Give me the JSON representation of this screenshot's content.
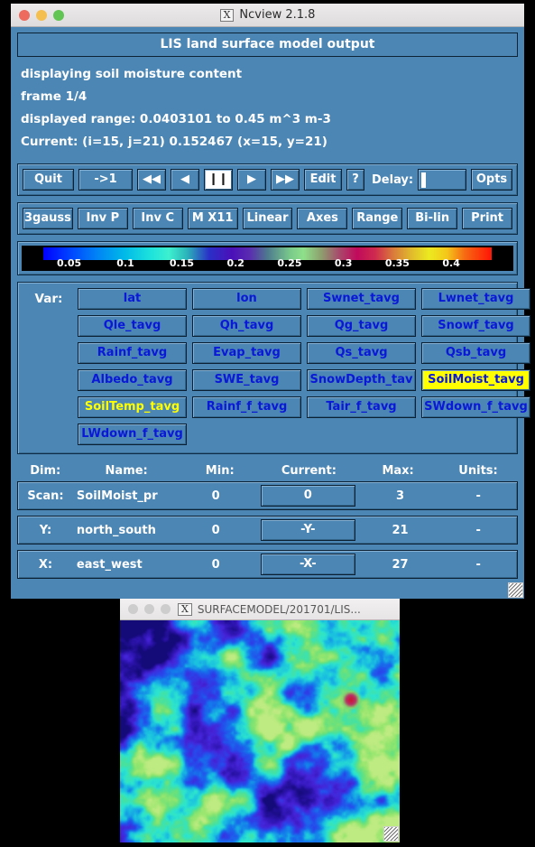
{
  "main_window": {
    "title": "Ncview 2.1.8",
    "x_logo": "X",
    "banner": "LIS land surface model output",
    "info": [
      "displaying soil moisture content",
      "frame 1/4",
      "displayed range: 0.0403101 to 0.45 m^3 m-3",
      "Current: (i=15, j=21) 0.152467 (x=15, y=21)"
    ]
  },
  "toolbar": {
    "quit": "Quit",
    "to_one": "->1",
    "rewind_fast": "◀◀",
    "rewind": "◀",
    "pause": "❙❙",
    "play": "▶",
    "forward_fast": "▶▶",
    "edit": "Edit",
    "help": "?",
    "delay_label": "Delay:",
    "delay_value": "",
    "opts": "Opts"
  },
  "options_bar": [
    "3gauss",
    "Inv P",
    "Inv C",
    "M X11",
    "Linear",
    "Axes",
    "Range",
    "Bi-lin",
    "Print"
  ],
  "colorbar": {
    "ticks": [
      "0.05",
      "0.1",
      "0.15",
      "0.2",
      "0.25",
      "0.3",
      "0.35",
      "0.4"
    ],
    "tick_positions": [
      9.5,
      21.0,
      32.5,
      43.5,
      54.5,
      65.5,
      76.5,
      87.5
    ],
    "min": "0.0403101",
    "max": "0.45",
    "units": "m^3 m-3"
  },
  "variables": {
    "label": "Var:",
    "selected": "SoilMoist_tavg",
    "rows": [
      [
        {
          "label": "lat",
          "state": "normal"
        },
        {
          "label": "lon",
          "state": "normal"
        },
        {
          "label": "Swnet_tavg",
          "state": "normal"
        },
        {
          "label": "Lwnet_tavg",
          "state": "normal"
        }
      ],
      [
        {
          "label": "Qle_tavg",
          "state": "normal"
        },
        {
          "label": "Qh_tavg",
          "state": "normal"
        },
        {
          "label": "Qg_tavg",
          "state": "normal"
        },
        {
          "label": "Snowf_tavg",
          "state": "normal"
        }
      ],
      [
        {
          "label": "Rainf_tavg",
          "state": "normal"
        },
        {
          "label": "Evap_tavg",
          "state": "normal"
        },
        {
          "label": "Qs_tavg",
          "state": "normal"
        },
        {
          "label": "Qsb_tavg",
          "state": "normal"
        }
      ],
      [
        {
          "label": "Albedo_tavg",
          "state": "normal"
        },
        {
          "label": "SWE_tavg",
          "state": "normal"
        },
        {
          "label": "SnowDepth_tav",
          "state": "normal"
        },
        {
          "label": "SoilMoist_tavg",
          "state": "active"
        }
      ],
      [
        {
          "label": "SoilTemp_tavg",
          "state": "yellowtext"
        },
        {
          "label": "Rainf_f_tavg",
          "state": "normal"
        },
        {
          "label": "Tair_f_tavg",
          "state": "normal"
        },
        {
          "label": "SWdown_f_tavg",
          "state": "normal"
        }
      ],
      [
        {
          "label": "LWdown_f_tavg",
          "state": "normal"
        }
      ]
    ]
  },
  "dim_table": {
    "headers": {
      "dim": "Dim:",
      "name": "Name:",
      "min": "Min:",
      "current": "Current:",
      "max": "Max:",
      "units": "Units:"
    },
    "rows": [
      {
        "dim": "Scan:",
        "name": "SoilMoist_pr",
        "min": "0",
        "current": "0",
        "max": "3",
        "units": "-"
      },
      {
        "dim": "Y:",
        "name": "north_south",
        "min": "0",
        "current": "-Y-",
        "max": "21",
        "units": "-"
      },
      {
        "dim": "X:",
        "name": "east_west",
        "min": "0",
        "current": "-X-",
        "max": "27",
        "units": "-"
      }
    ]
  },
  "image_window": {
    "title": "SURFACEMODEL/201701/LIS...",
    "x_logo": "X"
  },
  "colors": {
    "window_bg": "#4b86b4",
    "button_text": "#ffffff",
    "variable_text": "#0a18d8",
    "highlight": "#ffff00",
    "titlebar": "#eceaea"
  }
}
